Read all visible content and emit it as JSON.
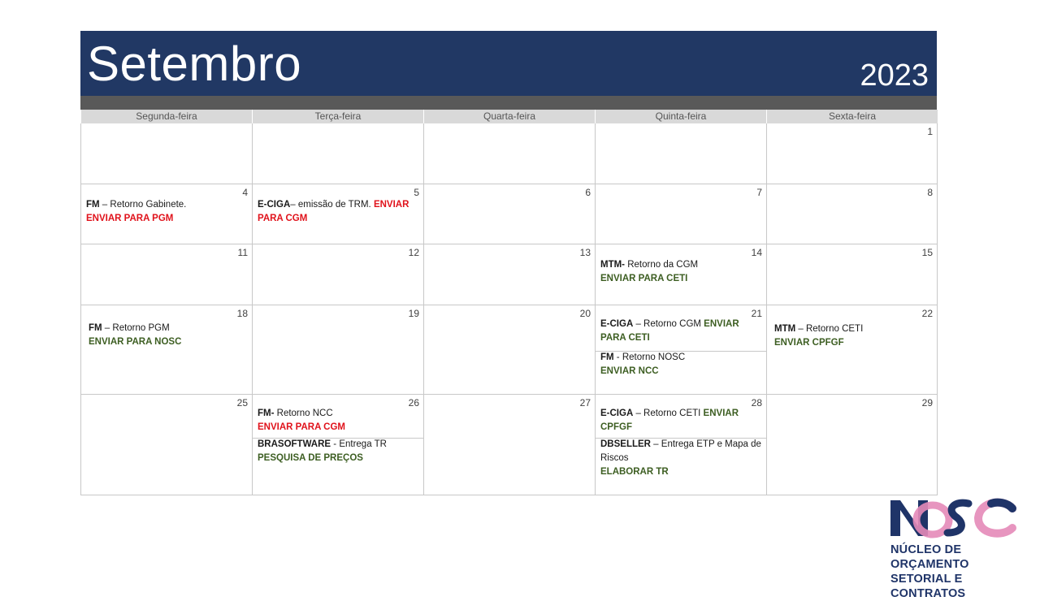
{
  "header": {
    "month": "Setembro",
    "year": "2023"
  },
  "weekdays": [
    "Segunda-feira",
    "Terça-feira",
    "Quarta-feira",
    "Quinta-feira",
    "Sexta-feira"
  ],
  "days": {
    "d1": "1",
    "d4": "4",
    "d5": "5",
    "d6": "6",
    "d7": "7",
    "d8": "8",
    "d11": "11",
    "d12": "12",
    "d13": "13",
    "d14": "14",
    "d15": "15",
    "d18": "18",
    "d19": "19",
    "d20": "20",
    "d21": "21",
    "d22": "22",
    "d25": "25",
    "d26": "26",
    "d27": "27",
    "d28": "28",
    "d29": "29"
  },
  "events": {
    "e4": {
      "org": "FM",
      "text": " – Retorno Gabinete.",
      "action": "ENVIAR PARA PGM"
    },
    "e5": {
      "org": "E-CIGA",
      "text": "– emissão de TRM. ",
      "action": "ENVIAR PARA CGM"
    },
    "e14": {
      "org": "MTM-",
      "text": " Retorno da CGM",
      "action": "ENVIAR PARA CETI"
    },
    "e18": {
      "org": "FM",
      "text": " – Retorno PGM",
      "action": "ENVIAR PARA NOSC"
    },
    "e21a": {
      "org": "E-CIGA",
      "text": " – Retorno CGM  ",
      "action": "ENVIAR PARA CETI"
    },
    "e21b": {
      "org": "FM",
      "text": " - Retorno NOSC",
      "action": "ENVIAR NCC"
    },
    "e22": {
      "org": "MTM",
      "text": " – Retorno CETI",
      "action": "ENVIAR CPFGF"
    },
    "e26a": {
      "org": "FM-",
      "text": " Retorno NCC",
      "action": "ENVIAR PARA CGM"
    },
    "e26b": {
      "org": "BRASOFTWARE",
      "text": "  - Entrega TR",
      "action": "PESQUISA  DE PREÇOS"
    },
    "e28a": {
      "org": "E-CIGA",
      "text": " – Retorno CETI  ",
      "action": "ENVIAR CPFGF"
    },
    "e28b": {
      "org": "DBSELLER",
      "text": " – Entrega ETP e Mapa de Riscos",
      "action": "ELABORAR TR"
    }
  },
  "logo": {
    "mark": "NOSC",
    "line1": "NÚCLEO DE ORÇAMENTO",
    "line2": "SETORIAL E CONTRATOS",
    "colors": {
      "navy": "#1f3468",
      "pink": "#e48ab8"
    }
  },
  "colors": {
    "header": "#213864",
    "bar": "#595959",
    "action_red": "#e0121b",
    "action_green": "#3d5e22"
  }
}
